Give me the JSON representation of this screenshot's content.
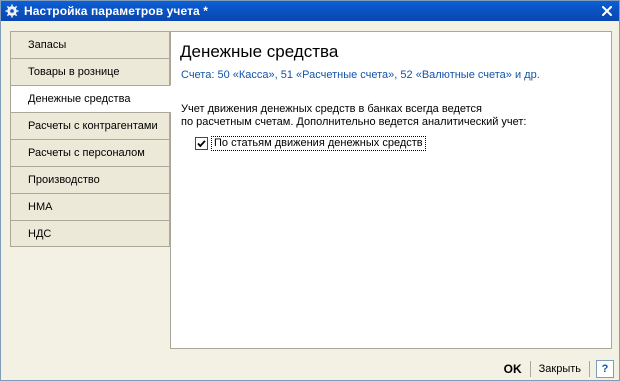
{
  "window": {
    "title": "Настройка параметров учета *"
  },
  "sidebar": {
    "items": [
      {
        "label": "Запасы",
        "active": false
      },
      {
        "label": "Товары в рознице",
        "active": false
      },
      {
        "label": "Денежные средства",
        "active": true
      },
      {
        "label": "Расчеты с контрагентами",
        "active": false
      },
      {
        "label": "Расчеты с персоналом",
        "active": false
      },
      {
        "label": "Производство",
        "active": false
      },
      {
        "label": "НМА",
        "active": false
      },
      {
        "label": "НДС",
        "active": false
      }
    ]
  },
  "panel": {
    "heading": "Денежные средства",
    "accounts": "Счета: 50 «Касса», 51 «Расчетные счета», 52 «Валютные счета» и др.",
    "desc_line1": "Учет движения денежных средств в банках всегда ведется",
    "desc_line2": "по расчетным счетам. Дополнительно ведется аналитический учет:",
    "checkbox_label": "По статьям движения денежных средств",
    "checkbox_checked": true
  },
  "footer": {
    "ok_label": "OK",
    "close_label": "Закрыть",
    "help_label": "?"
  },
  "colors": {
    "title_bar": "#0a4fbf",
    "accent_link": "#1255a8",
    "window_bg": "#f3f0e4"
  },
  "icons": {
    "app": "gear-icon",
    "close": "close-icon",
    "check": "checkmark-icon",
    "help": "help-icon"
  }
}
